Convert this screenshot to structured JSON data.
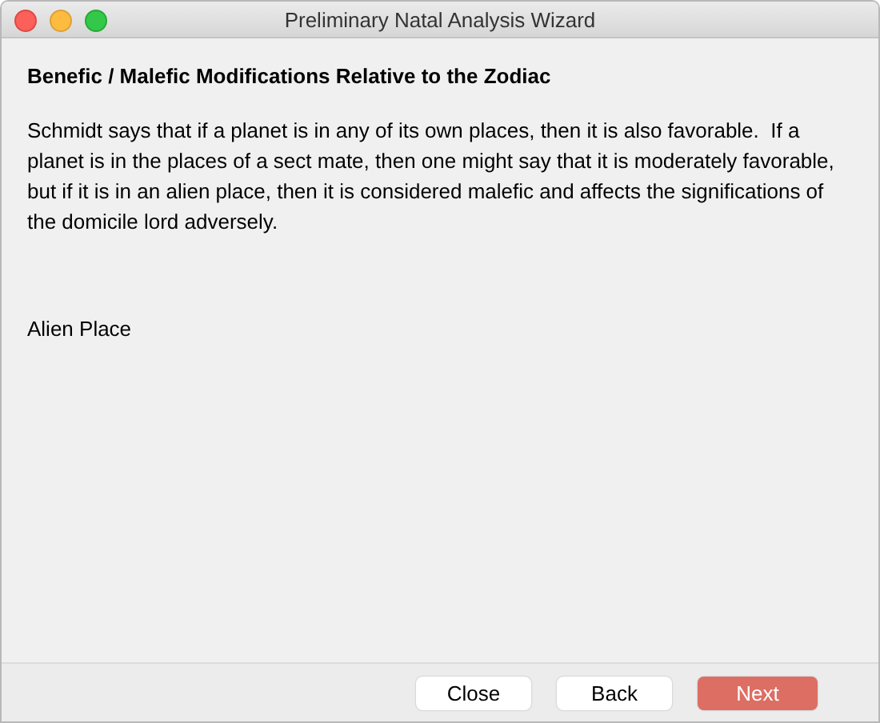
{
  "window": {
    "title": "Preliminary Natal Analysis Wizard"
  },
  "heading": "Benefic / Malefic Modifications Relative to the Zodiac",
  "description": "Schmidt says that if a planet is in any of its own places, then it is also favorable.  If a planet is in the places of a sect mate, then one might say that it is moderately favorable, but if it is in an alien place, then it is considered malefic and affects the significations of the domicile lord adversely.",
  "section_label": "Alien Place",
  "buttons": [
    {
      "label": "Close",
      "kind": "normal"
    },
    {
      "label": "Back",
      "kind": "normal"
    },
    {
      "label": "Next",
      "kind": "default"
    }
  ]
}
